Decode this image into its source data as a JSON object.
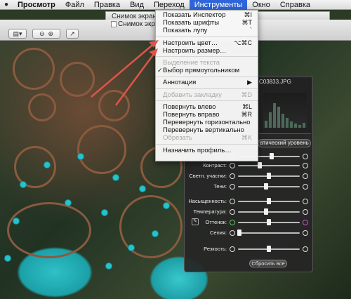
{
  "menubar": {
    "apple_icon": "apple-icon",
    "items": [
      "Просмотр",
      "Файл",
      "Правка",
      "Вид",
      "Переход",
      "Инструменты",
      "Окно",
      "Справка"
    ],
    "active": "Инструменты"
  },
  "back_window": {
    "title": "Снимок экрана 20"
  },
  "window": {
    "title": "Снимок экрана 2011"
  },
  "menu": {
    "items": [
      {
        "label": "Показать Инспектор",
        "shortcut": "⌘I",
        "enabled": true
      },
      {
        "label": "Показать шрифты",
        "shortcut": "⌘T",
        "enabled": true
      },
      {
        "label": "Показать лупу",
        "shortcut": "`",
        "enabled": true
      },
      {
        "label": "Настроить цвет…",
        "shortcut": "⌥⌘C",
        "enabled": true
      },
      {
        "label": "Настроить размер…",
        "shortcut": "",
        "enabled": true
      },
      {
        "label": "Выделение текста",
        "shortcut": "",
        "enabled": false
      },
      {
        "label": "Выбор прямоугольником",
        "shortcut": "",
        "enabled": true,
        "checked": true
      },
      {
        "label": "Аннотация",
        "shortcut": "▶",
        "enabled": true
      },
      {
        "label": "Добавить закладку",
        "shortcut": "⌘D",
        "enabled": false
      },
      {
        "label": "Повернуть влево",
        "shortcut": "⌘L",
        "enabled": true
      },
      {
        "label": "Повернуть вправо",
        "shortcut": "⌘R",
        "enabled": true
      },
      {
        "label": "Перевернуть горизонтально",
        "shortcut": "",
        "enabled": true
      },
      {
        "label": "Перевернуть вертикально",
        "shortcut": "",
        "enabled": true
      },
      {
        "label": "Обрезать",
        "shortcut": "⌘K",
        "enabled": false
      },
      {
        "label": "Назначить профиль…",
        "shortcut": "",
        "enabled": true
      }
    ]
  },
  "adjust_panel": {
    "filename": "C03833.JPG",
    "auto_button": "атический уровень",
    "sliders": [
      {
        "label": "",
        "value": 0.55
      },
      {
        "label": "Контраст:",
        "value": 0.35
      },
      {
        "label": "Светл. участки:",
        "value": 0.5
      },
      {
        "label": "Тени:",
        "value": 0.45
      },
      {
        "label": "Насыщенность:",
        "value": 0.5
      },
      {
        "label": "Температура:",
        "value": 0.45
      },
      {
        "label": "Оттенок:",
        "value": 0.5
      },
      {
        "label": "Сепия:",
        "value": 0.02
      },
      {
        "label": "Резкость:",
        "value": 0.5
      }
    ],
    "reset_button": "Сбросить все"
  }
}
